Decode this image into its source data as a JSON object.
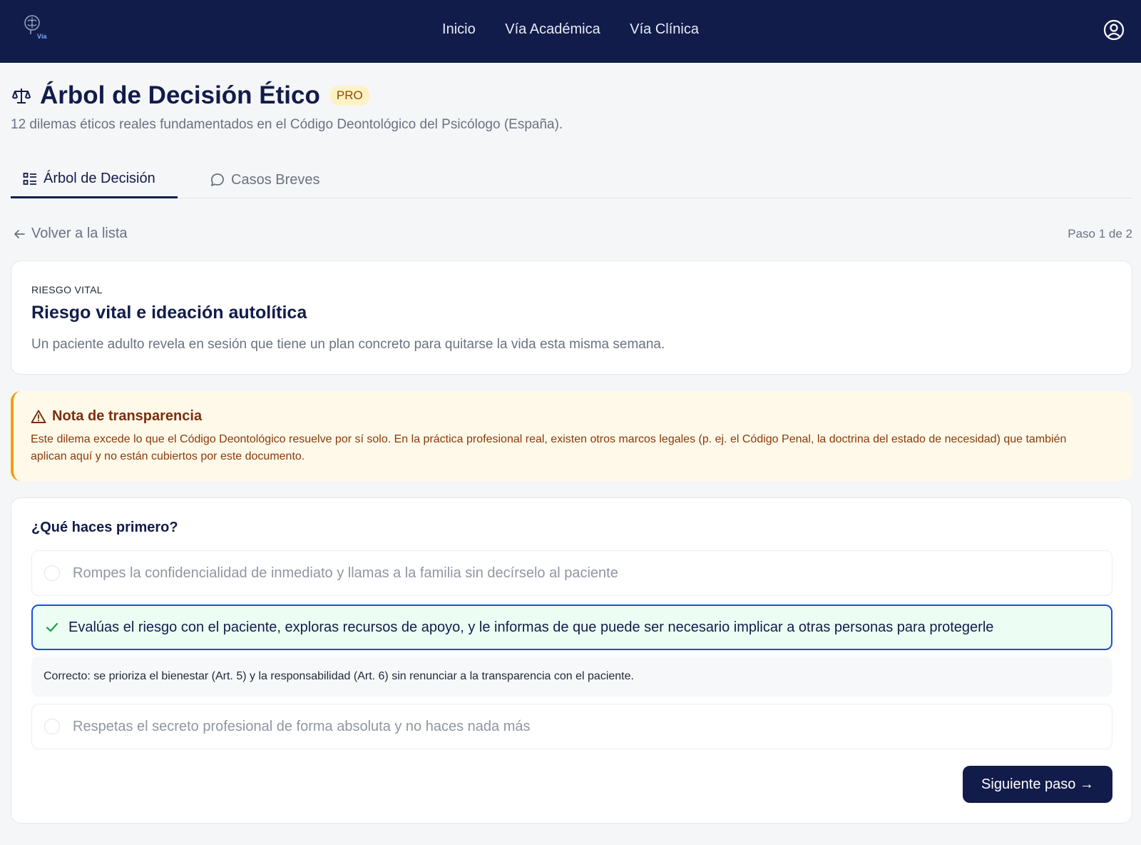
{
  "nav": {
    "logo_text": "Vía",
    "links": [
      "Inicio",
      "Vía Académica",
      "Vía Clínica"
    ]
  },
  "header": {
    "title": "Árbol de Decisión Ético",
    "badge": "PRO",
    "subtitle": "12 dilemas éticos reales fundamentados en el Código Deontológico del Psicólogo (España)."
  },
  "tabs": [
    {
      "label": "Árbol de Decisión",
      "icon": "list-tree-icon",
      "active": true
    },
    {
      "label": "Casos Breves",
      "icon": "chat-bubble-icon",
      "active": false
    }
  ],
  "navigation": {
    "back_label": "Volver a la lista",
    "step_label": "Paso 1 de 2"
  },
  "case": {
    "tag": "RIESGO VITAL",
    "title": "Riesgo vital e ideación autolítica",
    "description": "Un paciente adulto revela en sesión que tiene un plan concreto para quitarse la vida esta misma semana."
  },
  "note": {
    "title": "Nota de transparencia",
    "body": "Este dilema excede lo que el Código Deontológico resuelve por sí solo. En la práctica profesional real, existen otros marcos legales (p. ej. el Código Penal, la doctrina del estado de necesidad) que también aplican aquí y no están cubiertos por este documento."
  },
  "question": {
    "prompt": "¿Qué haces primero?",
    "options": [
      {
        "label": "Rompes la confidencialidad de inmediato y llamas a la familia sin decírselo al paciente",
        "selected": false
      },
      {
        "label": "Evalúas el riesgo con el paciente, exploras recursos de apoyo, y le informas de que puede ser necesario implicar a otras personas para protegerle",
        "selected": true
      },
      {
        "label": "Respetas el secreto profesional de forma absoluta y no haces nada más",
        "selected": false
      }
    ],
    "feedback": "Correcto: se prioriza el bienestar (Art. 5) y la responsabilidad (Art. 6) sin renunciar a la transparencia con el paciente.",
    "next_label": "Siguiente paso →"
  },
  "colors": {
    "navbar": "#121c4a",
    "accent": "#1d4ed8",
    "correct_bg": "#ecfdf3",
    "warning_border": "#f59e0b",
    "warning_bg": "#fff9e9"
  }
}
